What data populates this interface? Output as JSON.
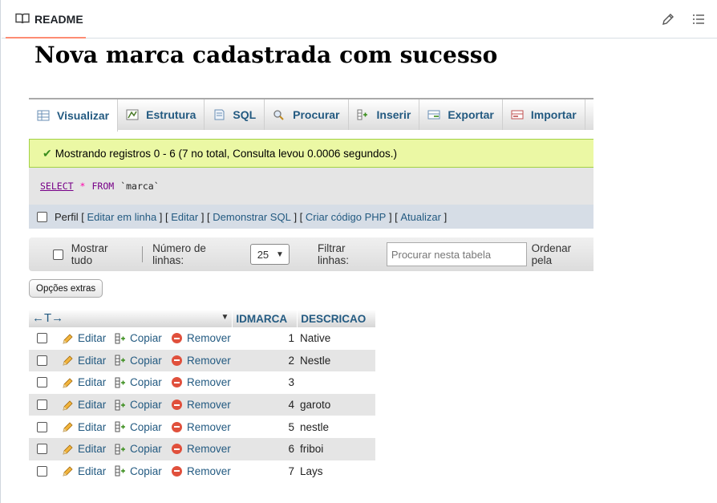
{
  "readme": {
    "tab_label": "README"
  },
  "page": {
    "title": "Nova marca cadastrada com sucesso"
  },
  "tabs": [
    {
      "label": "Visualizar",
      "icon": "browse-icon",
      "active": true
    },
    {
      "label": "Estrutura",
      "icon": "structure-icon"
    },
    {
      "label": "SQL",
      "icon": "sql-icon"
    },
    {
      "label": "Procurar",
      "icon": "search-icon"
    },
    {
      "label": "Inserir",
      "icon": "insert-icon"
    },
    {
      "label": "Exportar",
      "icon": "export-icon"
    },
    {
      "label": "Importar",
      "icon": "import-icon"
    }
  ],
  "success": {
    "message": "Mostrando registros 0 - 6 (7 no total, Consulta levou 0.0006 segundos.)"
  },
  "query": {
    "select": "SELECT",
    "star": "*",
    "from": "FROM",
    "table": "`marca`"
  },
  "tools": {
    "perfil": "Perfil",
    "links": [
      "Editar em linha",
      "Editar",
      "Demonstrar SQL",
      "Criar código PHP",
      "Atualizar"
    ]
  },
  "nav": {
    "show_all": "Mostrar tudo",
    "rows_label": "Número de linhas:",
    "rows_value": "25",
    "filter_label": "Filtrar linhas:",
    "filter_placeholder": "Procurar nesta tabela",
    "order_label": "Ordenar pela"
  },
  "extra_options": "Opções extras",
  "grid": {
    "arrows": "←T→",
    "columns": [
      "IDMARCA",
      "DESCRICAO"
    ],
    "actions": {
      "edit": "Editar",
      "copy": "Copiar",
      "remove": "Remover"
    },
    "rows": [
      {
        "id": "1",
        "desc": "Native"
      },
      {
        "id": "2",
        "desc": "Nestle"
      },
      {
        "id": "3",
        "desc": ""
      },
      {
        "id": "4",
        "desc": "garoto"
      },
      {
        "id": "5",
        "desc": "nestle"
      },
      {
        "id": "6",
        "desc": "friboi"
      },
      {
        "id": "7",
        "desc": "Lays"
      }
    ]
  },
  "colors": {
    "link": "#235a81",
    "success_bg": "#ebf8a4",
    "accent_underline": "#fd8c73",
    "remove": "#e0503c"
  }
}
